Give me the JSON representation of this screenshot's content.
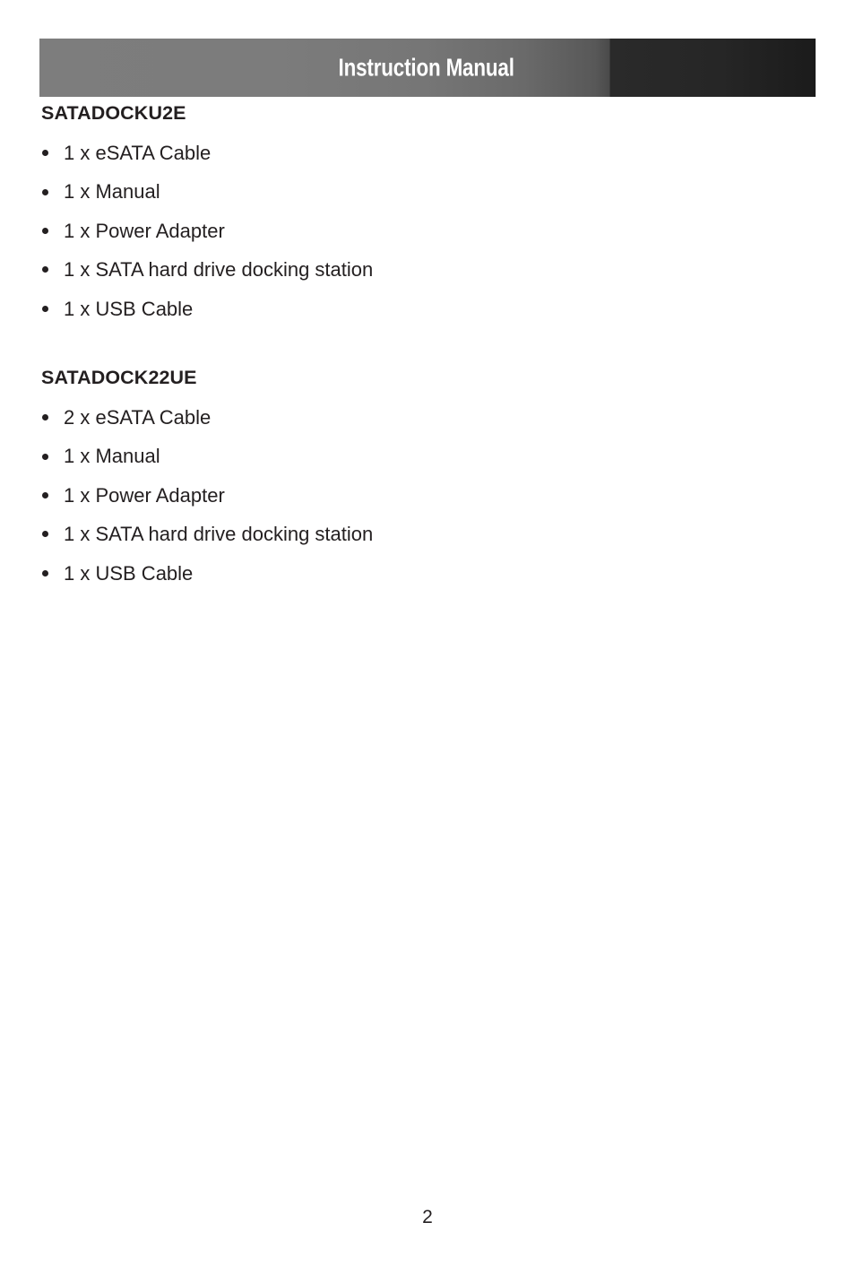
{
  "document": {
    "header": {
      "title": "Instruction Manual",
      "gradient_start_color": "#7c7c7c",
      "gradient_end_color": "#1b1b1b",
      "title_color": "#ffffff"
    },
    "text_color": "#231f20",
    "background_color": "#ffffff",
    "sections": [
      {
        "heading": "SATADOCKU2E",
        "items": [
          "1 x eSATA Cable",
          "1 x Manual",
          "1 x Power Adapter",
          "1 x SATA hard drive docking station",
          "1 x USB Cable"
        ]
      },
      {
        "heading": "SATADOCK22UE",
        "items": [
          "2 x eSATA Cable",
          "1 x Manual",
          "1 x Power Adapter",
          "1 x SATA hard drive docking station",
          "1 x USB Cable"
        ]
      }
    ],
    "footer": {
      "page_number": "2"
    }
  }
}
